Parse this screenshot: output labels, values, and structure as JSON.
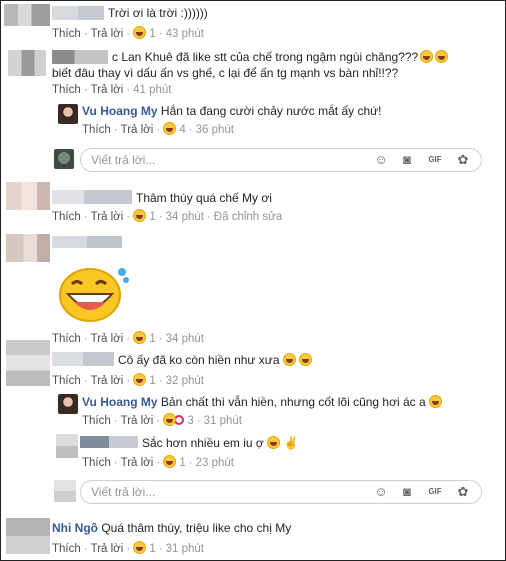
{
  "c1": {
    "text": "Trời ơi là trời :))))))",
    "like": "Thích",
    "reply": "Trả lời",
    "count": "1",
    "time": "43 phút"
  },
  "c2": {
    "line1": "c Lan Khuê đã like stt của chế trong ngậm ngùi chăng???",
    "line2": "biết đâu thay vì dấu ấn vs ghế, c lại để ấn tg mạnh vs bàn nhỉ!!??",
    "like": "Thích",
    "reply": "Trả lời",
    "time": "41 phút"
  },
  "r1": {
    "name": "Vu Hoang My",
    "text": "Hắn ta đang cười chảy nước mắt ấy chứ!",
    "like": "Thích",
    "reply": "Trả lời",
    "count": "4",
    "time": "36 phút"
  },
  "reply_box": {
    "placeholder": "Viết trả lời..."
  },
  "c3": {
    "text": "Thâm thúy quá chế My ơi",
    "like": "Thích",
    "reply": "Trả lời",
    "count": "1",
    "time": "34 phút",
    "edited": "Đã chỉnh sửa"
  },
  "c4": {
    "like": "Thích",
    "reply": "Trả lời",
    "count": "1",
    "time": "34 phút"
  },
  "c5": {
    "text": "Cô ấy đã ko còn hiền như xưa",
    "like": "Thích",
    "reply": "Trả lời",
    "count": "1",
    "time": "32 phút"
  },
  "r2": {
    "name": "Vu Hoang My",
    "text": "Bản chất thì vẫn hiền, nhưng cốt lõi cũng hơi ác a",
    "like": "Thích",
    "reply": "Trả lời",
    "count": "3",
    "time": "31 phút"
  },
  "r3": {
    "text": "Sắc hơn nhiều em iu ợ",
    "like": "Thích",
    "reply": "Trả lời",
    "count": "1",
    "time": "23 phút"
  },
  "reply_box2": {
    "placeholder": "Viết trả lời..."
  },
  "c6": {
    "name": "Nhi Ngô",
    "text": "Quá thâm thúy, triệu like cho chị My",
    "like": "Thích",
    "reply": "Trả lời",
    "count": "1",
    "time": "31 phút"
  },
  "icons": [
    "smiley-icon",
    "camera-icon",
    "gif-icon",
    "sticker-icon"
  ],
  "colors": {
    "link": "#365899",
    "meta": "#90949c",
    "border": "#ccd0d5"
  }
}
